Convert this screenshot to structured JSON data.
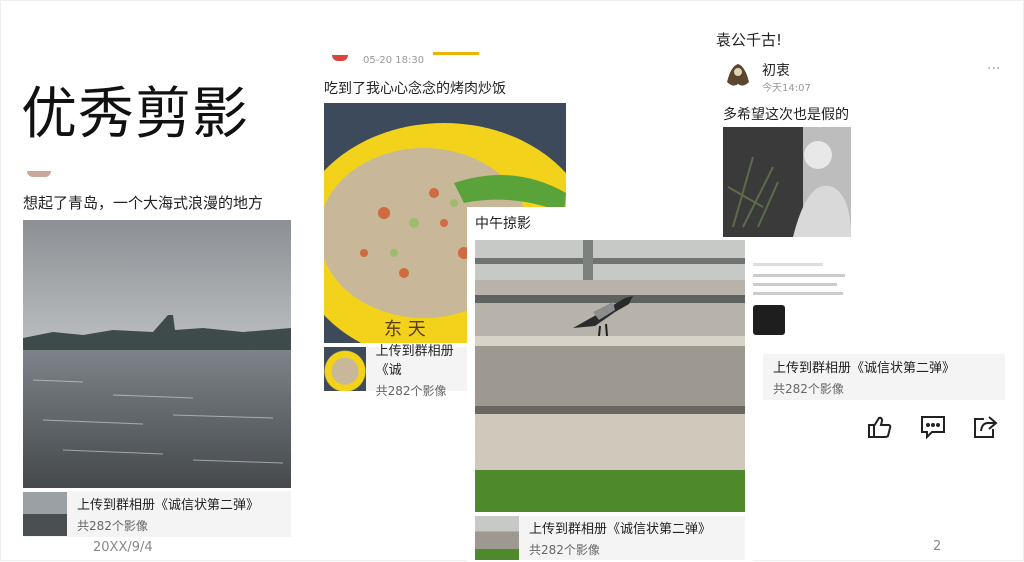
{
  "slide": {
    "title": "优秀剪影",
    "footer_date": "20XX/9/4",
    "page_number": "2"
  },
  "post_left": {
    "caption": "想起了青岛，一个大海式浪漫的地方",
    "album_line1": "上传到群相册《诚信状第二弹》",
    "album_line2": "共282个影像"
  },
  "post_middle": {
    "timestamp": "05-20 18:30",
    "caption": "吃到了我心心念念的烤肉炒饭",
    "album_line1": "上传到群相册《诚",
    "album_line2": "共282个影像"
  },
  "post_noon": {
    "caption": "中午掠影",
    "album_line1": "上传到群相册《诚信状第二弹》",
    "album_line2": "共282个影像"
  },
  "post_right": {
    "headline": "袁公千古!",
    "username": "初衷",
    "time": "今天14:07",
    "more": "···",
    "caption": "多希望这次也是假的",
    "album_line1": "上传到群相册《诚信状第二弹》",
    "album_line2": "共282个影像",
    "actions": [
      "like-icon",
      "comment-icon",
      "share-icon"
    ]
  },
  "colors": {
    "accent_yellow": "#e8b400",
    "album_bg": "#f4f4f4"
  }
}
